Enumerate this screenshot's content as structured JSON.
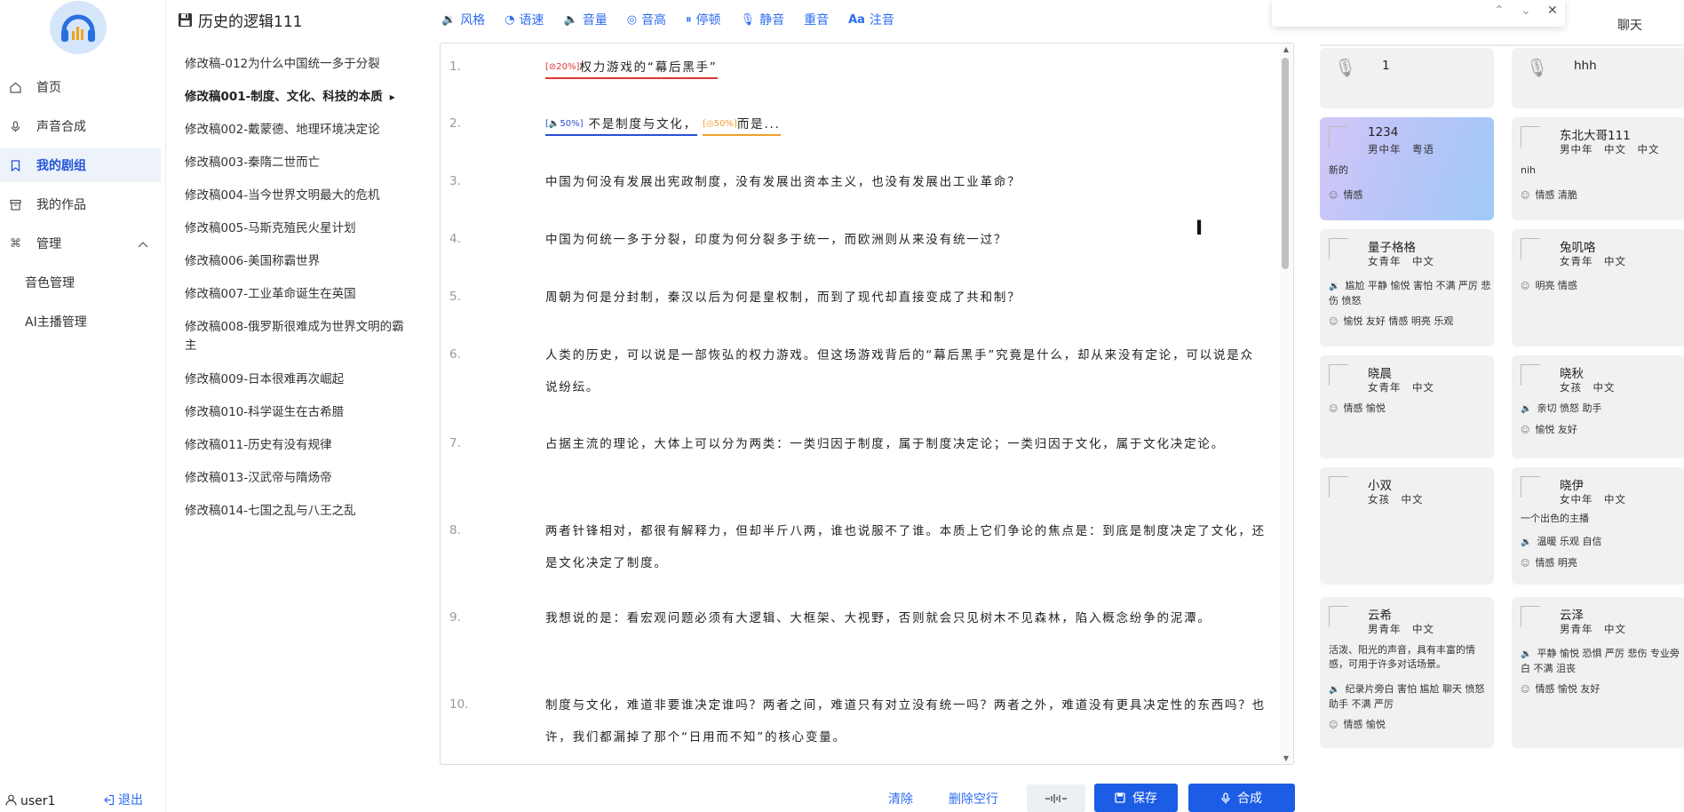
{
  "nav": {
    "items": [
      {
        "label": "首页",
        "icon": "home-icon"
      },
      {
        "label": "声音合成",
        "icon": "mic-icon"
      },
      {
        "label": "我的剧组",
        "icon": "bookmark-icon",
        "active": true
      },
      {
        "label": "我的作品",
        "icon": "archive-icon"
      },
      {
        "label": "管理",
        "icon": "command-icon"
      }
    ],
    "sub_items": [
      "音色管理",
      "AI主播管理"
    ],
    "user_name": "user1",
    "logout_label": "退出"
  },
  "project": {
    "title": "历史的逻辑111",
    "scripts": [
      "修改稿-012为什么中国统一多于分裂",
      "修改稿001-制度、文化、科技的本质",
      "修改稿002-戴蒙德、地理环境决定论",
      "修改稿003-秦隋二世而亡",
      "修改稿004-当今世界文明最大的危机",
      "修改稿005-马斯克殖民火星计划",
      "修改稿006-美国称霸世界",
      "修改稿007-工业革命诞生在英国",
      "修改稿008-俄罗斯很难成为世界文明的霸主",
      "修改稿009-日本很难再次崛起",
      "修改稿010-科学诞生在古希腊",
      "修改稿011-历史有没有规律",
      "修改稿013-汉武帝与隋炀帝",
      "修改稿014-七国之乱与八王之乱"
    ]
  },
  "toolbar": {
    "items": [
      {
        "label": "风格",
        "icon": "style-icon"
      },
      {
        "label": "语速",
        "icon": "speed-icon"
      },
      {
        "label": "音量",
        "icon": "volume-icon"
      },
      {
        "label": "音高",
        "icon": "pitch-icon"
      },
      {
        "label": "停顿",
        "icon": "pause-icon"
      },
      {
        "label": "静音",
        "icon": "mute-icon"
      },
      {
        "label": "重音",
        "icon": ""
      },
      {
        "label": "注音",
        "icon": "phonetic-icon"
      }
    ]
  },
  "editor": {
    "line1": {
      "num": "1.",
      "tag": "[⊘20%]",
      "text": "权力游戏的“幕后黑手”"
    },
    "line2": {
      "num": "2.",
      "tag1": "[🔈50%]",
      "text1": "不是制度与文化，",
      "tag2": "[◎50%]",
      "text2": "而是..."
    },
    "lines": [
      {
        "num": "3.",
        "text": "中国为何没有发展出宪政制度，没有发展出资本主义，也没有发展出工业革命？"
      },
      {
        "num": "4.",
        "text": "中国为何统一多于分裂，印度为何分裂多于统一，而欧洲则从来没有统一过？"
      },
      {
        "num": "5.",
        "text": "周朝为何是分封制，秦汉以后为何是皇权制，而到了现代却直接变成了共和制？"
      },
      {
        "num": "6.",
        "text": "人类的历史，可以说是一部恢弘的权力游戏。但这场游戏背后的“幕后黑手”究竟是什么，却从来没有定论，可以说是众说纷纭。"
      },
      {
        "num": "7.",
        "text": "占据主流的理论，大体上可以分为两类：一类归因于制度，属于制度决定论；一类归因于文化，属于文化决定论。"
      },
      {
        "num": "8.",
        "text": "两者针锋相对，都很有解释力，但却半斤八两，谁也说服不了谁。本质上它们争论的焦点是：到底是制度决定了文化，还是文化决定了制度。"
      },
      {
        "num": "9.",
        "text": "我想说的是：看宏观问题必须有大逻辑、大框架、大视野，否则就会只见树木不见森林，陷入概念纷争的泥潭。"
      },
      {
        "num": "10.",
        "text": "制度与文化，难道非要谁决定谁吗？两者之间，难道只有对立没有统一吗？两者之外，难道没有更具决定性的东西吗？也许，我们都漏掉了那个“日用而不知”的核心变量。"
      }
    ]
  },
  "actions": {
    "clear": "清除",
    "remove_blank": "删除空行",
    "save": "保存",
    "synthesize": "合成"
  },
  "panel": {
    "chat_tab": "聊天",
    "voices": [
      {
        "name": "1",
        "type": "mic"
      },
      {
        "name": "hhh",
        "type": "mic"
      },
      {
        "name": "1234",
        "meta": "男中年　粤语",
        "desc": "新的",
        "tags": "情感",
        "selected": true
      },
      {
        "name": "东北大哥111",
        "meta": "男中年　中文　中文",
        "desc": "nih",
        "tags": "情感 清脆"
      },
      {
        "name": "量子格格",
        "meta": "女青年　中文",
        "tags_a": "尴尬 平静 愉悦 害怕 不满 严厉 悲伤 愤怒",
        "tags": "愉悦 友好 情感 明亮 乐观"
      },
      {
        "name": "兔叽咯",
        "meta": "女青年　中文",
        "tags": "明亮 情感"
      },
      {
        "name": "晓晨",
        "meta": "女青年　中文",
        "tags": "情感 愉悦"
      },
      {
        "name": "晓秋",
        "meta": "女孩　中文",
        "tags_a": "亲切 愤怒 助手",
        "tags": "愉悦 友好"
      },
      {
        "name": "小双",
        "meta": "女孩　中文"
      },
      {
        "name": "晓伊",
        "meta": "女中年　中文",
        "desc": "一个出色的主播",
        "tags_a": "温暖 乐观 自信",
        "tags": "情感 明亮"
      },
      {
        "name": "云希",
        "meta": "男青年　中文",
        "desc": "活泼、阳光的声音，具有丰富的情感，可用于许多对话场景。",
        "tags_a": "纪录片旁白 害怕 尴尬 聊天 愤怒 助手 不满 严厉",
        "tags": "情感 愉悦"
      },
      {
        "name": "云泽",
        "meta": "男青年　中文",
        "tags_a": "平静 愉悦 恐惧 严厉 悲伤 专业旁白 不满 沮丧",
        "tags": "情感 愉悦 友好"
      }
    ]
  }
}
